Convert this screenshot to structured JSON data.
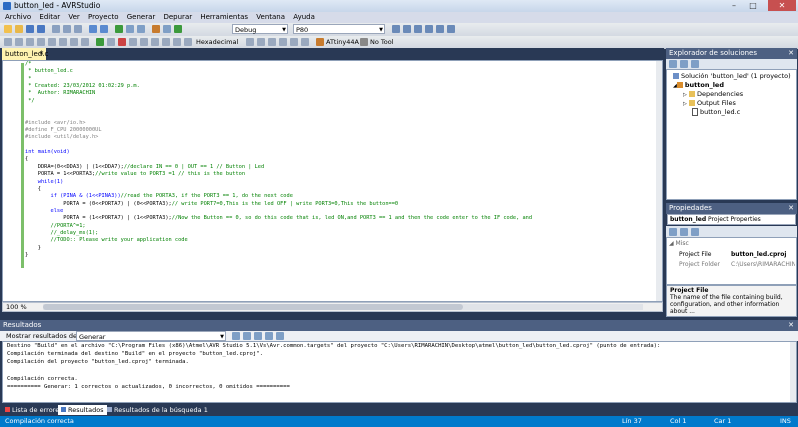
{
  "window": {
    "title": "button_led - AVRStudio"
  },
  "menu": [
    "Archivo",
    "Editar",
    "Ver",
    "Proyecto",
    "Generar",
    "Depurar",
    "Herramientas",
    "Ventana",
    "Ayuda"
  ],
  "toolbar": {
    "config_value": "Debug",
    "search_value": "P80",
    "hex_label": "Hexadecimal",
    "device_label": "ATtiny44A",
    "tool_label": "No Tool"
  },
  "editor": {
    "tab_label": "button_led.c",
    "zoom": "100 %",
    "code_lines": [
      {
        "t": "/*",
        "c": "cm"
      },
      {
        "t": " * button_led.c",
        "c": "cm"
      },
      {
        "t": " *",
        "c": "cm"
      },
      {
        "t": " * Created: 23/03/2012 01:02:29 p.m.",
        "c": "cm"
      },
      {
        "t": " *  Author: RIMARACHIN",
        "c": "cm"
      },
      {
        "t": " */",
        "c": "cm"
      },
      {
        "t": "",
        "c": "nm"
      },
      {
        "t": "",
        "c": "nm"
      },
      {
        "t": "#include <avr/io.h>",
        "c": "nm"
      },
      {
        "t": "#define F_CPU 20000000UL",
        "c": "nm"
      },
      {
        "t": "#include <util/delay.h>",
        "c": "nm"
      },
      {
        "t": "",
        "c": "nm"
      },
      {
        "t": "int main(void)",
        "c": "nm"
      },
      {
        "t": "{",
        "c": "nm"
      },
      {
        "t": "    DDRA=(0<<DDA3) | (1<<DDA7);//declare IN == 0 | OUT == 1 // Button | Led",
        "c": "nm"
      },
      {
        "t": "    PORTA = 1<<PORTA3;//write value to PORT3 =1 // this is the button",
        "c": "nm"
      },
      {
        "t": "    while(1)",
        "c": "nm"
      },
      {
        "t": "    {",
        "c": "nm"
      },
      {
        "t": "        if (PINA & (1<<PINA3))//read the PORTA3, if the PORT3 == 1, do the next code",
        "c": "nm"
      },
      {
        "t": "            PORTA = (0<<PORTA7) | (0<<PORTA3);// write PORT7=0,This is the led OFF | write PORT3=0,This the button==0",
        "c": "nm"
      },
      {
        "t": "        else",
        "c": "nm"
      },
      {
        "t": "            PORTA = (1<<PORTA7) | (1<<PORTA3);//Now the Button == 0, so do this code that is, led ON,and PORT3 == 1 and then the code enter to the IF code, and",
        "c": "nm"
      },
      {
        "t": "        //PORTA^=1;",
        "c": "cm"
      },
      {
        "t": "        //_delay_ms(1);",
        "c": "cm"
      },
      {
        "t": "        //TODO:: Please write your application code",
        "c": "cm"
      },
      {
        "t": "    }",
        "c": "nm"
      },
      {
        "t": "}",
        "c": "nm"
      }
    ]
  },
  "solution_explorer": {
    "title": "Explorador de soluciones",
    "items": [
      "Solución 'button_led' (1 proyecto)",
      "button_led",
      "Dependencies",
      "Output Files",
      "button_led.c"
    ]
  },
  "properties": {
    "title": "Propiedades",
    "selector_name": "button_led",
    "selector_type": "Project Properties",
    "category": "Misc",
    "rows": [
      {
        "name": "Project File",
        "value": "button_led.cproj"
      },
      {
        "name": "Project Folder",
        "value": "C:\\Users\\RIMARACHIN"
      }
    ],
    "desc_title": "Project File",
    "desc_text": "The name of the file containing build, configuration, and other information about ..."
  },
  "output": {
    "title": "Resultados",
    "show_label": "Mostrar resultados desde:",
    "source_value": "Generar",
    "lines": [
      "Destino \"Build\" en el archivo \"C:\\Program Files (x86)\\Atmel\\AVR Studio 5.1\\Vs\\Avr.common.targets\" del proyecto \"C:\\Users\\RIMARACHIN\\Desktop\\atmel\\button_led\\button_led.cproj\" (punto de entrada):",
      "Compilación terminada del destino \"Build\" en el proyecto \"button_led.cproj\".",
      "Compilación del proyecto \"button_led.cproj\" terminada.",
      "",
      "Compilación correcta.",
      "========== Generar: 1 correctos o actualizados, 0 incorrectos, 0 omitidos =========="
    ]
  },
  "bottom_tabs": [
    "Lista de errores",
    "Resultados",
    "Resultados de la búsqueda 1"
  ],
  "status": {
    "message": "Compilación correcta",
    "line": "Lín 37",
    "col": "Col 1",
    "car": "Car 1",
    "ins": "INS"
  }
}
